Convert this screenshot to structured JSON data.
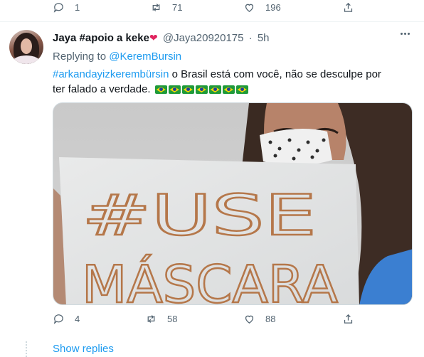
{
  "previous_tweet": {
    "reply_count": "1",
    "retweet_count": "71",
    "like_count": "196"
  },
  "tweet": {
    "display_name": "Jaya #apoio a keke",
    "handle": "@Jaya20920175",
    "separator": "·",
    "time": "5h",
    "replying_label": "Replying to",
    "replying_to": "@KeremBursin",
    "hashtag": "#arkandayizkerembürsin",
    "text": " o Brasil está com você, não se desculpe por ter falado a verdade.",
    "flag_count": 7,
    "media_text_line1": "#USE",
    "media_text_line2": "MÁSCARA",
    "reply_count": "4",
    "retweet_count": "58",
    "like_count": "88"
  },
  "show_replies": "Show replies",
  "colors": {
    "accent": "#1d9bf0",
    "muted": "#536471",
    "heart": "#e0245e"
  },
  "icons": [
    "reply-icon",
    "retweet-icon",
    "like-icon",
    "share-icon",
    "more-icon",
    "heart-emoji",
    "brazil-flag-emoji"
  ]
}
